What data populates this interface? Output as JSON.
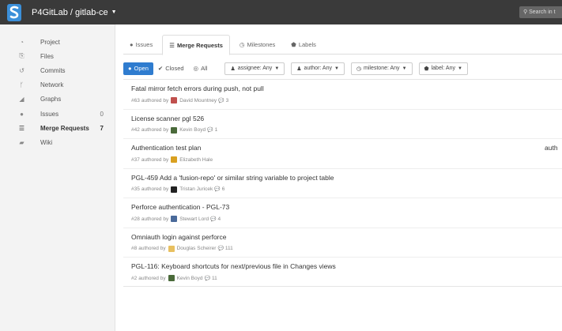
{
  "header": {
    "project_path": "P4GitLab / gitlab-ce",
    "search_placeholder": "Search in t"
  },
  "sidebar": {
    "items": [
      {
        "icon": "dashboard-icon",
        "label": "Project",
        "count": ""
      },
      {
        "icon": "files-icon",
        "label": "Files",
        "count": ""
      },
      {
        "icon": "history-icon",
        "label": "Commits",
        "count": ""
      },
      {
        "icon": "branch-icon",
        "label": "Network",
        "count": ""
      },
      {
        "icon": "area-chart-icon",
        "label": "Graphs",
        "count": ""
      },
      {
        "icon": "exclamation-circle-icon",
        "label": "Issues",
        "count": "0"
      },
      {
        "icon": "list-icon",
        "label": "Merge Requests",
        "count": "7"
      },
      {
        "icon": "book-icon",
        "label": "Wiki",
        "count": ""
      }
    ],
    "active": "Merge Requests"
  },
  "tabs": [
    {
      "icon": "exclamation-circle-icon",
      "label": "Issues"
    },
    {
      "icon": "list-icon",
      "label": "Merge Requests"
    },
    {
      "icon": "clock-icon",
      "label": "Milestones"
    },
    {
      "icon": "tag-icon",
      "label": "Labels"
    }
  ],
  "filters": {
    "states": [
      {
        "icon": "exclamation-circle-icon",
        "label": "Open"
      },
      {
        "icon": "check-circle-icon",
        "label": "Closed"
      },
      {
        "icon": "compass-icon",
        "label": "All"
      }
    ],
    "dropdowns": [
      {
        "icon": "user-icon",
        "label": "assignee: Any"
      },
      {
        "icon": "user-icon",
        "label": "author: Any"
      },
      {
        "icon": "clock-icon",
        "label": "milestone: Any"
      },
      {
        "icon": "tag-icon",
        "label": "label: Any"
      }
    ]
  },
  "merge_requests": [
    {
      "title": "Fatal mirror fetch errors during push, not pull",
      "number": "#63",
      "authored_by": "authored by",
      "author": "David Mountney",
      "comments": "3",
      "avatar_color": "#c0504d"
    },
    {
      "title": "License scanner pgl 526",
      "number": "#42",
      "authored_by": "authored by",
      "author": "Kevin Boyd",
      "comments": "1",
      "avatar_color": "#4a6a3a"
    },
    {
      "title": "Authentication test plan",
      "number": "#37",
      "authored_by": "authored by",
      "author": "Elizabeth Hale",
      "comments": "",
      "avatar_color": "#d9a020",
      "right_text": "auth"
    },
    {
      "title": "PGL-459 Add a 'fusion-repo' or similar string variable to project table",
      "number": "#35",
      "authored_by": "authored by",
      "author": "Tristan Juricek",
      "comments": "6",
      "avatar_color": "#222222"
    },
    {
      "title": "Perforce authentication - PGL-73",
      "number": "#28",
      "authored_by": "authored by",
      "author": "Stewart Lord",
      "comments": "4",
      "avatar_color": "#4a6a9a"
    },
    {
      "title": "Omniauth login against perforce",
      "number": "#8",
      "authored_by": "authored by",
      "author": "Douglas Scheirer",
      "comments": "111",
      "avatar_color": "#e8c060"
    },
    {
      "title": "PGL-116: Keyboard shortcuts for next/previous file in Changes views",
      "number": "#2",
      "authored_by": "authored by",
      "author": "Kevin Boyd",
      "comments": "11",
      "avatar_color": "#4a6a3a"
    }
  ],
  "colors": {
    "topbar": "#3a3a3a",
    "accent": "#2f7ccf",
    "logo": "#3b8fd9"
  }
}
